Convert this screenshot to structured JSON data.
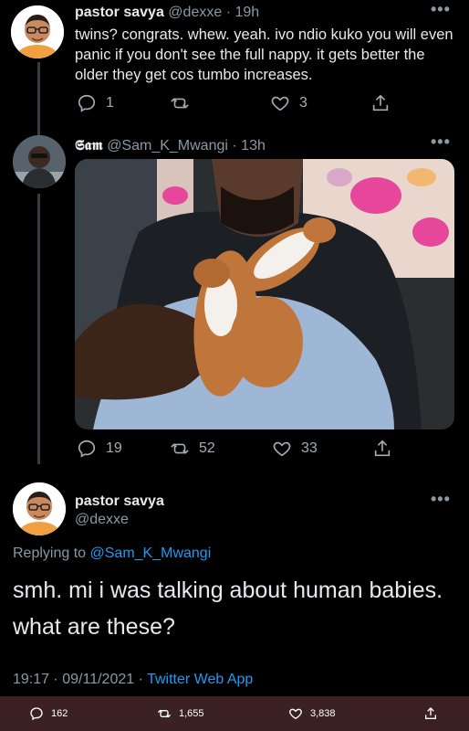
{
  "tweet1": {
    "display_name": "pastor savya",
    "handle": "@dexxe",
    "time": "19h",
    "text": "twins? congrats. whew. yeah. ivo ndio kuko you will even panic if you don't see the full nappy. it gets better the older they get cos tumbo increases.",
    "replies": "1",
    "retweets": "",
    "likes": "3"
  },
  "tweet2": {
    "display_name": "𝕾𝖆𝖒",
    "handle": "@Sam_K_Mwangi",
    "time": "13h",
    "replies": "19",
    "retweets": "52",
    "likes": "33"
  },
  "tweet3": {
    "display_name": "pastor savya",
    "handle": "@dexxe",
    "replying_prefix": "Replying to",
    "replying_to": "@Sam_K_Mwangi",
    "text": "smh. mi i was talking about human babies. what are these?",
    "timestamp": "19:17 · 09/11/2021 · ",
    "source": "Twitter Web App"
  },
  "bottombar": {
    "replies": "162",
    "retweets": "1,655",
    "likes": "3,838"
  },
  "colors": {
    "link": "#1d9bf0",
    "muted": "#8b98a5",
    "bar": "#3b2121"
  },
  "icons": [
    "reply-icon",
    "retweet-icon",
    "like-icon",
    "share-icon",
    "more-icon"
  ]
}
